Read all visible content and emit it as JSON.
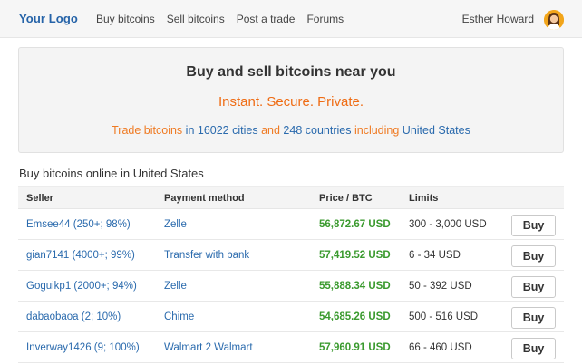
{
  "nav": {
    "logo": "Your Logo",
    "links": [
      {
        "label": "Buy bitcoins"
      },
      {
        "label": "Sell bitcoins"
      },
      {
        "label": "Post a trade"
      },
      {
        "label": "Forums"
      }
    ],
    "user_name": "Esther Howard",
    "avatar_icon": "user-avatar"
  },
  "hero": {
    "title": "Buy and sell bitcoins near you",
    "tagline": "Instant. Secure. Private.",
    "line": {
      "part1": "Trade bitcoins",
      "part2": "in 16022 cities",
      "part3": "and",
      "part4": "248 countries",
      "part5": "including",
      "part6": "United States"
    }
  },
  "section": {
    "title": "Buy bitcoins online in United States"
  },
  "table": {
    "headers": {
      "seller": "Seller",
      "payment": "Payment method",
      "price": "Price / BTC",
      "limits": "Limits"
    },
    "rows": [
      {
        "seller": "Emsee44 (250+; 98%)",
        "payment": "Zelle",
        "price": "56,872.67 USD",
        "limits": "300 - 3,000 USD",
        "action": "Buy"
      },
      {
        "seller": "gian7141 (4000+; 99%)",
        "payment": "Transfer with bank",
        "price": "57,419.52 USD",
        "limits": "6 - 34 USD",
        "action": "Buy"
      },
      {
        "seller": "Goguikp1 (2000+; 94%)",
        "payment": "Zelle",
        "price": "55,888.34 USD",
        "limits": "50 - 392 USD",
        "action": "Buy"
      },
      {
        "seller": "dabaobaoa (2; 10%)",
        "payment": "Chime",
        "price": "54,685.26 USD",
        "limits": "500 - 516 USD",
        "action": "Buy"
      },
      {
        "seller": "Inverway1426 (9; 100%)",
        "payment": "Walmart 2 Walmart",
        "price": "57,960.91 USD",
        "limits": "66 - 460 USD",
        "action": "Buy"
      }
    ]
  },
  "colors": {
    "brand_blue": "#2563a8",
    "accent_orange": "#ef6c14",
    "price_green": "#3a9a2e"
  }
}
